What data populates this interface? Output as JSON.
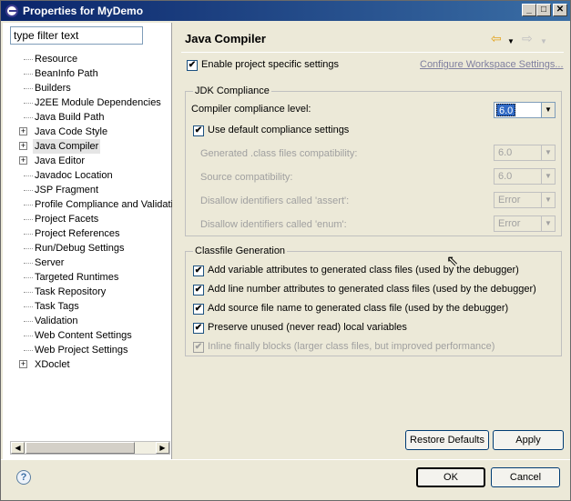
{
  "window": {
    "title": "Properties for MyDemo",
    "min": "_",
    "max": "□",
    "close": "✕"
  },
  "filter": {
    "placeholder": "type filter text",
    "value": "type filter text"
  },
  "tree": [
    {
      "label": "Resource",
      "expandable": false,
      "selected": false
    },
    {
      "label": "BeanInfo Path",
      "expandable": false,
      "selected": false
    },
    {
      "label": "Builders",
      "expandable": false,
      "selected": false
    },
    {
      "label": "J2EE Module Dependencies",
      "expandable": false,
      "selected": false
    },
    {
      "label": "Java Build Path",
      "expandable": false,
      "selected": false
    },
    {
      "label": "Java Code Style",
      "expandable": true,
      "selected": false
    },
    {
      "label": "Java Compiler",
      "expandable": true,
      "selected": true
    },
    {
      "label": "Java Editor",
      "expandable": true,
      "selected": false
    },
    {
      "label": "Javadoc Location",
      "expandable": false,
      "selected": false
    },
    {
      "label": "JSP Fragment",
      "expandable": false,
      "selected": false
    },
    {
      "label": "Profile Compliance and Validatic",
      "expandable": false,
      "selected": false
    },
    {
      "label": "Project Facets",
      "expandable": false,
      "selected": false
    },
    {
      "label": "Project References",
      "expandable": false,
      "selected": false
    },
    {
      "label": "Run/Debug Settings",
      "expandable": false,
      "selected": false
    },
    {
      "label": "Server",
      "expandable": false,
      "selected": false
    },
    {
      "label": "Targeted Runtimes",
      "expandable": false,
      "selected": false
    },
    {
      "label": "Task Repository",
      "expandable": false,
      "selected": false
    },
    {
      "label": "Task Tags",
      "expandable": false,
      "selected": false
    },
    {
      "label": "Validation",
      "expandable": false,
      "selected": false
    },
    {
      "label": "Web Content Settings",
      "expandable": false,
      "selected": false
    },
    {
      "label": "Web Project Settings",
      "expandable": false,
      "selected": false
    },
    {
      "label": "XDoclet",
      "expandable": true,
      "selected": false
    }
  ],
  "page": {
    "title": "Java Compiler",
    "enable_project_settings": {
      "label": "Enable project specific settings",
      "checked": true
    },
    "configure_link": "Configure Workspace Settings...",
    "jdk": {
      "group_title": "JDK Compliance",
      "compliance_label": "Compiler compliance level:",
      "compliance_value": "6.0",
      "use_default": {
        "label": "Use default compliance settings",
        "checked": true
      },
      "generated_label": "Generated .class files compatibility:",
      "generated_value": "6.0",
      "source_label": "Source compatibility:",
      "source_value": "6.0",
      "assert_label": "Disallow identifiers called 'assert':",
      "assert_value": "Error",
      "enum_label": "Disallow identifiers called 'enum':",
      "enum_value": "Error"
    },
    "classfile": {
      "group_title": "Classfile Generation",
      "options": [
        {
          "label": "Add variable attributes to generated class files (used by the debugger)",
          "checked": true,
          "disabled": false
        },
        {
          "label": "Add line number attributes to generated class files (used by the debugger)",
          "checked": true,
          "disabled": false
        },
        {
          "label": "Add source file name to generated class file (used by the debugger)",
          "checked": true,
          "disabled": false
        },
        {
          "label": "Preserve unused (never read) local variables",
          "checked": true,
          "disabled": false
        },
        {
          "label": "Inline finally blocks (larger class files, but improved performance)",
          "checked": true,
          "disabled": true
        }
      ]
    },
    "restore_defaults": "Restore Defaults",
    "apply": "Apply"
  },
  "footer": {
    "help": "?",
    "ok": "OK",
    "cancel": "Cancel"
  },
  "icons": {
    "back": "back-arrow-icon",
    "forward": "forward-arrow-icon",
    "menu": "dropdown-menu-icon"
  }
}
